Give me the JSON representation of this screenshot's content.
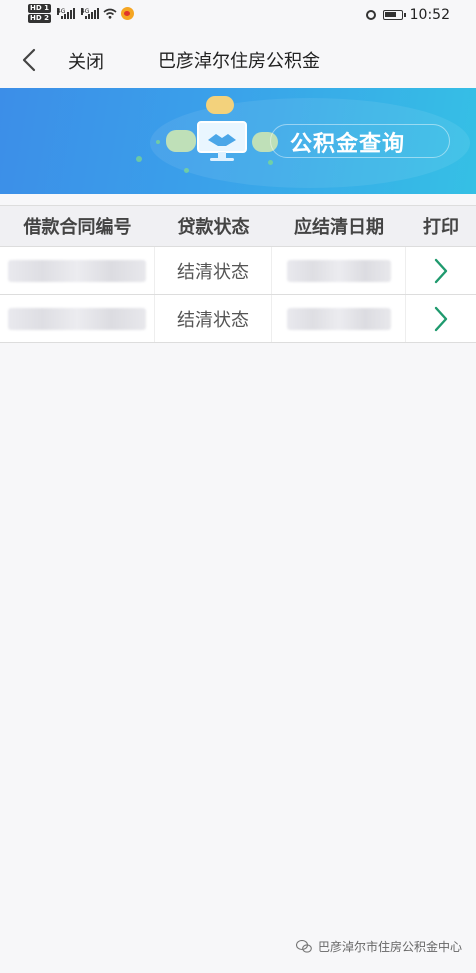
{
  "status_bar": {
    "hd1": "HD 1",
    "hd2": "HD 2",
    "net1": "4G",
    "net2": "4G",
    "time": "10:52"
  },
  "nav": {
    "back_icon": "chevron-left-icon",
    "close_label": "关闭",
    "title": "巴彦淖尔住房公积金"
  },
  "banner": {
    "title": "公积金查询",
    "colors": {
      "start": "#3c8ee8",
      "end": "#35c0e5"
    }
  },
  "table": {
    "headers": [
      "借款合同编号",
      "贷款状态",
      "应结清日期",
      "打印"
    ],
    "rows": [
      {
        "status": "结清状态"
      },
      {
        "status": "结清状态"
      }
    ],
    "print_icon": "chevron-right-icon",
    "accent": "#1f9a6e"
  },
  "watermark": {
    "text": "巴彦淖尔市住房公积金中心"
  }
}
